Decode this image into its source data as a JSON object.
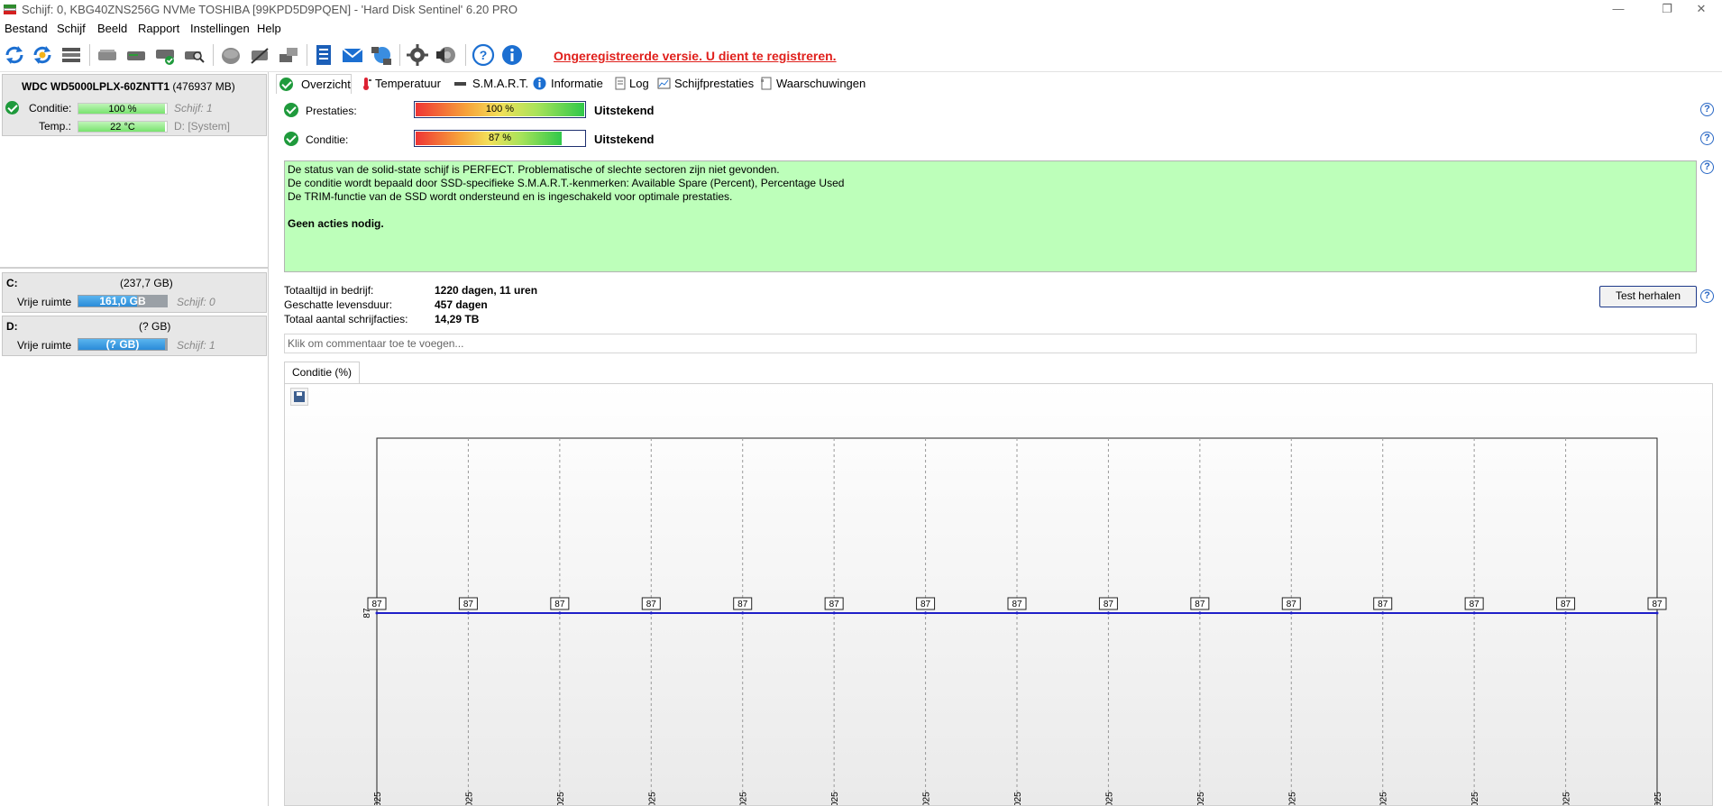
{
  "window": {
    "title": "Schijf: 0, KBG40ZNS256G NVMe TOSHIBA [99KPD5D9PQEN]  -  'Hard Disk Sentinel' 6.20 PRO",
    "minimize": "—",
    "restore": "❐",
    "close": "✕"
  },
  "menu": [
    "Bestand",
    "Schijf",
    "Beeld",
    "Rapport",
    "Instellingen",
    "Help"
  ],
  "toolbar": {
    "unregistered_notice": "Ongeregistreerde versie. U dient te registreren.",
    "icons": [
      "refresh-icon",
      "refresh-all-icon",
      "disk-list-icon",
      "disk-gray-icon",
      "disk-test-icon",
      "disk-ok-icon",
      "disk-search-icon",
      "disk-surface-icon",
      "disk-wipe-icon",
      "disk-export-icon",
      "report-icon",
      "mail-icon",
      "network-icon",
      "gear-icon",
      "speaker-icon",
      "help-icon",
      "info-icon"
    ]
  },
  "left_panel": {
    "disk": {
      "name": "WDC WD5000LPLX-60ZNTT1",
      "size": "(476937 MB)",
      "condition_label": "Conditie:",
      "condition_value": "100 %",
      "condition_fraction": 1.0,
      "disk_index": "Schijf: 1",
      "temp_label": "Temp.:",
      "temp_value": "22 °C",
      "temp_fraction": 1.0,
      "drive_letter": "D: [System]"
    },
    "volumes": [
      {
        "letter": "C:",
        "size": "(237,7 GB)",
        "free_label": "Vrije ruimte",
        "free_value": "161,0 GB",
        "free_fraction": 0.68,
        "disk": "Schijf: 0"
      },
      {
        "letter": "D:",
        "size": "(? GB)",
        "free_label": "Vrije ruimte",
        "free_value": "(? GB)",
        "free_fraction": 1.0,
        "disk": "Schijf: 1"
      }
    ]
  },
  "tabs": [
    {
      "label": "Overzicht",
      "icon": "check-icon",
      "active": true
    },
    {
      "label": "Temperatuur",
      "icon": "thermometer-icon",
      "active": false
    },
    {
      "label": "S.M.A.R.T.",
      "icon": "smart-icon",
      "active": false
    },
    {
      "label": "Informatie",
      "icon": "info-icon",
      "active": false
    },
    {
      "label": "Log",
      "icon": "log-icon",
      "active": false
    },
    {
      "label": "Schijfprestaties",
      "icon": "chart-icon",
      "active": false
    },
    {
      "label": "Waarschuwingen",
      "icon": "warning-icon",
      "active": false
    }
  ],
  "overview": {
    "performance_label": "Prestaties:",
    "performance_value": "100 %",
    "performance_fraction": 1.0,
    "performance_rating": "Uitstekend",
    "condition_label": "Conditie:",
    "condition_value": "87 %",
    "condition_fraction": 0.87,
    "condition_rating": "Uitstekend",
    "status_lines": [
      "De status van de solid-state schijf is PERFECT. Problematische of slechte sectoren zijn niet gevonden.",
      "De conditie wordt bepaald door SSD-specifieke S.M.A.R.T.-kenmerken:  Available Spare (Percent), Percentage Used",
      "De TRIM-functie van de SSD wordt ondersteund en is ingeschakeld voor optimale prestaties."
    ],
    "status_action": "Geen acties nodig.",
    "status_color": "#bdffba",
    "power_on_label": "Totaaltijd in bedrijf:",
    "power_on_value": "1220 dagen, 11 uren",
    "lifetime_label": "Geschatte levensduur:",
    "lifetime_value": "457 dagen",
    "writes_label": "Totaal aantal schrijfacties:",
    "writes_value": "14,29 TB",
    "retest_button": "Test herhalen",
    "comment_placeholder": "Klik om commentaar toe te voegen..."
  },
  "chart_tab": "Conditie (%)",
  "chart_data": {
    "type": "line",
    "title": "Conditie (%)",
    "y_axis_label": "87",
    "x_tick_label": "025",
    "series": [
      {
        "values": [
          87,
          87,
          87,
          87,
          87,
          87,
          87,
          87,
          87,
          87,
          87,
          87,
          87,
          87,
          87
        ]
      }
    ],
    "point_labels": [
      "87",
      "87",
      "87",
      "87",
      "87",
      "87",
      "87",
      "87",
      "87",
      "87",
      "87",
      "87",
      "87",
      "87",
      "87"
    ],
    "line_color": "#1f1fc8",
    "grid": true
  }
}
